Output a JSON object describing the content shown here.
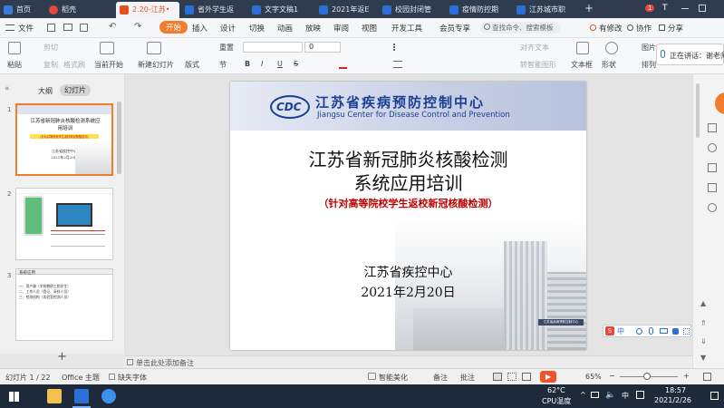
{
  "tabs": [
    {
      "label": "首页",
      "color": "#3a7bd5"
    },
    {
      "label": "稻壳",
      "color": "#e8483c"
    },
    {
      "label": "2.20-江苏•",
      "color": "#e0531f",
      "active": true
    },
    {
      "label": "省外学生返",
      "color": "#2b6fd6"
    },
    {
      "label": "文字文稿1",
      "color": "#2b6fd6"
    },
    {
      "label": "2021年返E",
      "color": "#2b6fd6"
    },
    {
      "label": "校园封闭管",
      "color": "#2b6fd6"
    },
    {
      "label": "疫情防控期",
      "color": "#2b6fd6"
    },
    {
      "label": "江苏城市职",
      "color": "#2b6fd6"
    }
  ],
  "tab_add": "+",
  "window_right": {
    "badge": "1",
    "title_icon": "T"
  },
  "menu": {
    "file": "文件",
    "items": [
      "开始",
      "插入",
      "设计",
      "切换",
      "动画",
      "放映",
      "审阅",
      "视图",
      "开发工具",
      "会员专享"
    ],
    "search_placeholder": "查找命令、搜索模板",
    "changes": "有修改",
    "collab": "协作",
    "share": "分享"
  },
  "ribbon": {
    "paste": "粘贴",
    "cut": "剪切",
    "copy": "复制",
    "format_painter": "格式刷",
    "start_from_current": "当前开始",
    "new_slide": "新建幻灯片",
    "layout": "版式",
    "section": "节",
    "reset": "重置",
    "font_size": "0",
    "bold": "B",
    "italic": "I",
    "underline": "U",
    "strike": "S",
    "align": "对齐文本",
    "convert": "转智能图形",
    "textbox": "文本框",
    "shape": "形状",
    "arrange": "排列",
    "picture": "图片",
    "font_input": ""
  },
  "speaking": "正在讲话：谢老师",
  "panel": {
    "outline": "大纲",
    "slides": "幻灯片",
    "add": "+"
  },
  "thumbs": [
    {
      "num": "1",
      "title": "江苏省新冠肺炎核酸检测系统应用培训",
      "sub": "（针对高等院校学生返校新冠核酸检测）",
      "org": "江苏省疾控中心",
      "date": "2021年2月20日"
    },
    {
      "num": "2"
    },
    {
      "num": "3",
      "title": "系统应用",
      "lines": [
        "一、用户端（学校教职工和学生）",
        "二、工作人员（登记、采样人员）",
        "三、检测机构（实验室检测人员）"
      ]
    }
  ],
  "slide": {
    "header_cn": "江苏省疾病预防控制中心",
    "header_en": "Jiangsu Center for Disease Control and Prevention",
    "logo": "CDC",
    "title1": "江苏省新冠肺炎核酸检测",
    "title2": "系统应用培训",
    "subtitle": "（针对高等院校学生返校新冠核酸检测）",
    "org": "江苏省疾控中心",
    "date": "2021年2月20日",
    "building_sign": "江苏省疾病预防控制中心"
  },
  "notes_placeholder": "单击此处添加备注",
  "ime": {
    "s": "S",
    "lang": "中"
  },
  "status": {
    "slide_count": "幻灯片 1 / 22",
    "theme": "Office 主题",
    "missing_font": "缺失字体",
    "beautify": "智能美化",
    "notes": "备注",
    "comments": "批注",
    "zoom": "65%",
    "minus": "−",
    "plus": "+"
  },
  "taskbar": {
    "temp": "62°C",
    "cpu": "CPU温度",
    "lang": "中",
    "time": "18:57",
    "date": "2021/2/26"
  }
}
